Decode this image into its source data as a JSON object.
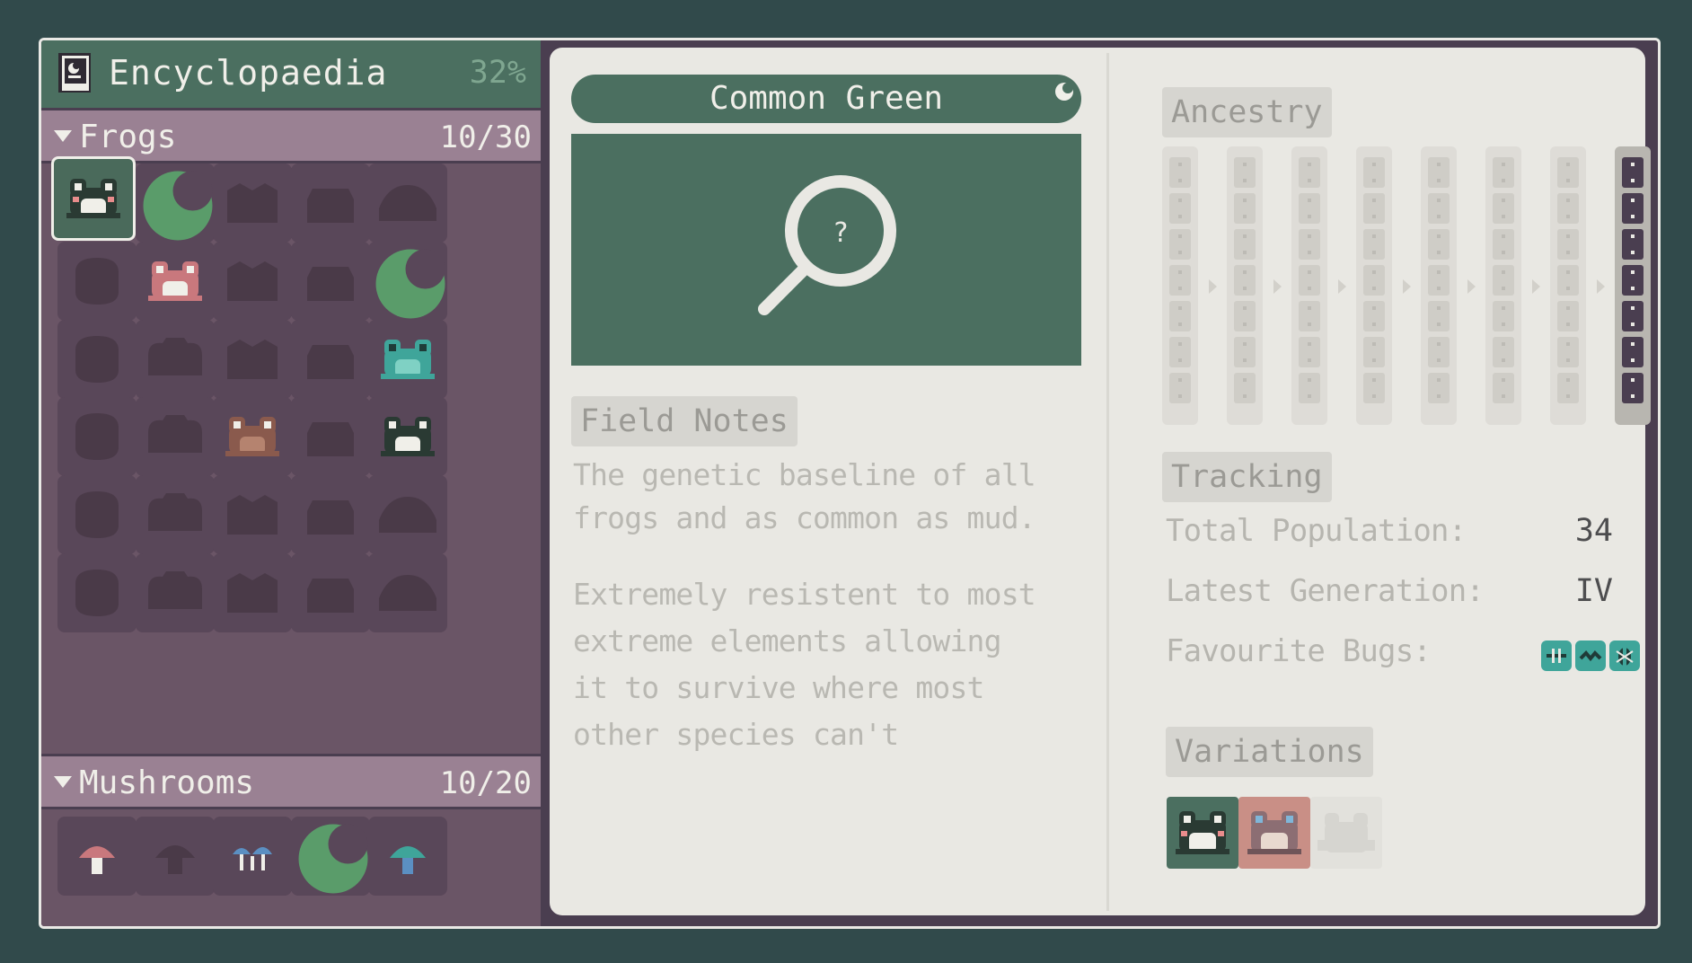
{
  "encyclopedia": {
    "title": "Encyclopaedia",
    "completion": "32%",
    "icon": "book-icon"
  },
  "sections": [
    {
      "label": "Frogs",
      "count": "10/30",
      "icon": "chevron-down-icon"
    },
    {
      "label": "Mushrooms",
      "count": "10/20",
      "icon": "chevron-down-icon"
    }
  ],
  "frogs_grid": {
    "columns": 5,
    "rows": 6,
    "discovered": 10,
    "selected": "Common Green"
  },
  "detail": {
    "name": "Common Green",
    "preview_icon": "magnifier-question-icon",
    "preview_symbol": "?",
    "field_notes_label": "Field Notes",
    "paragraph1": [
      "The genetic baseline of all",
      "frogs and as common as mud."
    ],
    "paragraph2": [
      "Extremely resistent to most",
      "extreme elements allowing",
      "it to survive where most",
      "other species can't"
    ]
  },
  "ancestry": {
    "label": "Ancestry",
    "generations": 8
  },
  "tracking": {
    "label": "Tracking",
    "rows": [
      {
        "label": "Total Population:",
        "value": "34"
      },
      {
        "label": "Latest Generation:",
        "value": "IV"
      },
      {
        "label": "Favourite Bugs:",
        "value": ""
      }
    ],
    "bugs": [
      "dragonfly-icon",
      "worm-icon",
      "beetle-icon"
    ]
  },
  "variations": {
    "label": "Variations",
    "items": [
      "green-frog",
      "pink-frog",
      "unknown-frog"
    ]
  },
  "colors": {
    "accent_green": "#4b6f60",
    "panel_bg": "#e9e8e3",
    "section_pink": "#9a8193",
    "dark_purple": "#4a3e50",
    "teal": "#3fa59a"
  }
}
